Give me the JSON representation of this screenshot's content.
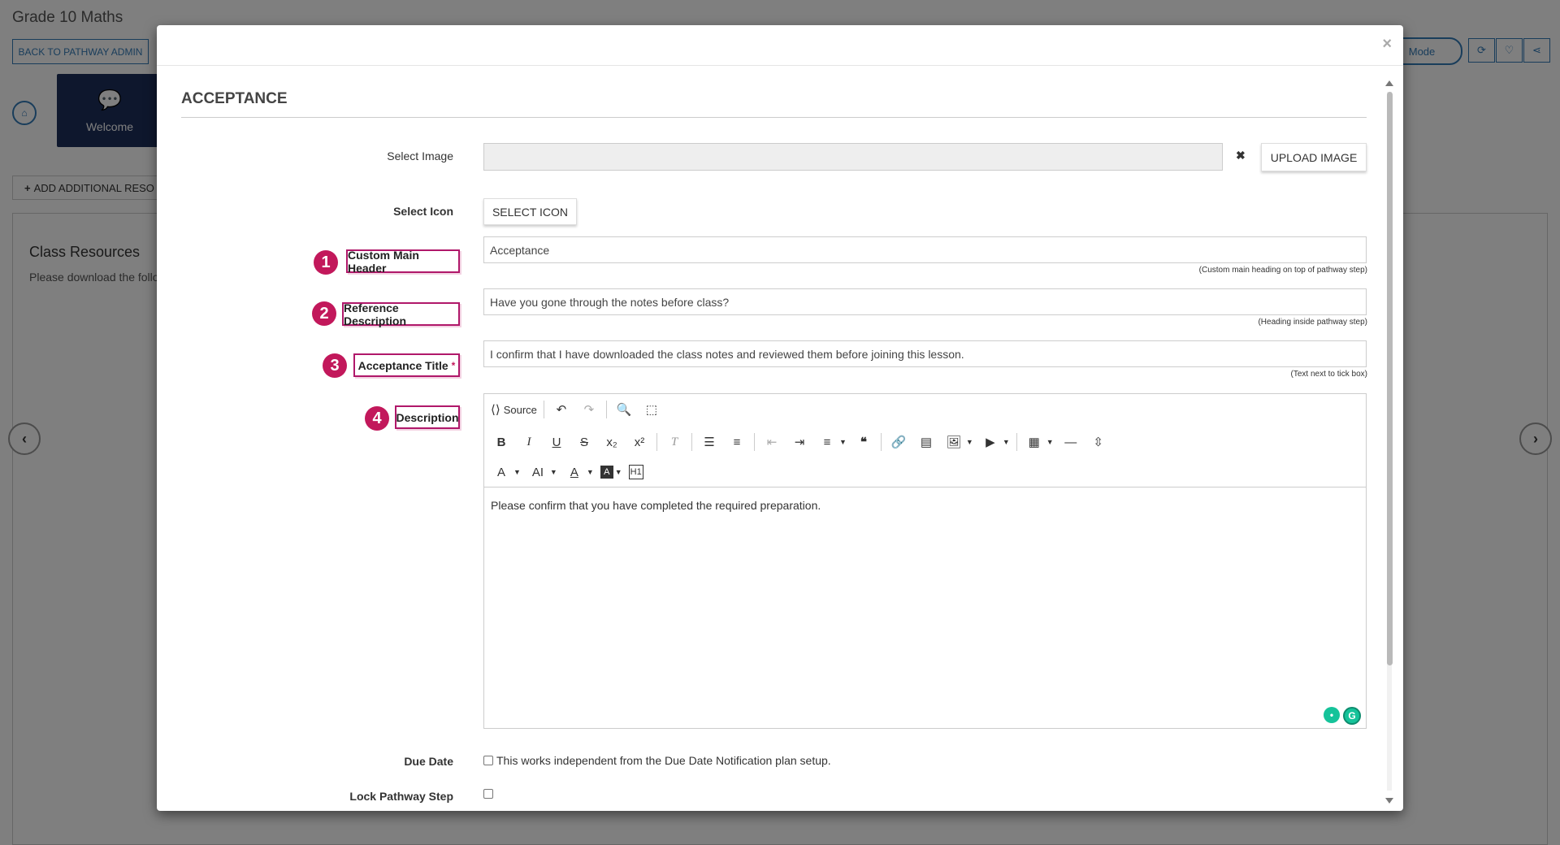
{
  "background": {
    "page_title": "Grade 10 Maths",
    "back_button": "BACK TO PATHWAY ADMIN",
    "welcome_label": "Welcome",
    "add_resources": "ADD ADDITIONAL RESO",
    "panel_title": "Class Resources",
    "panel_text": "Please download the follo",
    "mode_button": "Mode"
  },
  "modal": {
    "close": "×",
    "section_title": "ACCEPTANCE",
    "select_image": {
      "label": "Select Image",
      "value": "",
      "clear": "✖",
      "upload_button": "UPLOAD IMAGE"
    },
    "select_icon": {
      "label": "Select Icon",
      "button": "SELECT ICON"
    },
    "custom_main_header": {
      "badge": "1",
      "label": "Custom Main Header",
      "value": "Acceptance",
      "hint": "(Custom main heading on top of pathway step)"
    },
    "reference_description": {
      "badge": "2",
      "label": "Reference Description",
      "value": "Have you gone through the notes before class?",
      "hint": "(Heading inside pathway step)"
    },
    "acceptance_title": {
      "badge": "3",
      "label": "Acceptance Title",
      "required": "*",
      "value": "I confirm that I have downloaded the class notes and reviewed them before joining this lesson.",
      "hint": "(Text next to tick box)"
    },
    "description": {
      "badge": "4",
      "label": "Description",
      "source_label": "Source",
      "content": "Please confirm that you have completed the required preparation."
    },
    "due_date": {
      "label": "Due Date",
      "text": "This works independent from the Due Date Notification plan setup."
    },
    "lock_step": {
      "label": "Lock Pathway Step"
    }
  },
  "colors": {
    "accent": "#337ab7",
    "highlight": "#c2185b",
    "welcome_card": "#1c2e5a"
  }
}
